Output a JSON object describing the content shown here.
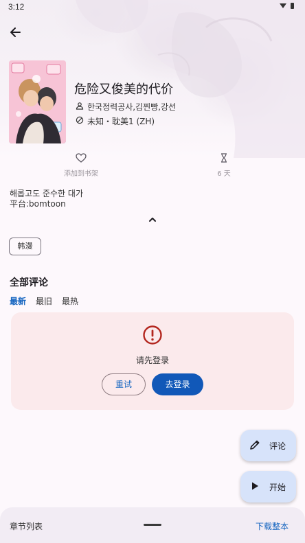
{
  "status_bar": {
    "time": "3:12",
    "icons": "▼ ▮"
  },
  "comic": {
    "title": "危险又俊美的代价",
    "authors": "한국정력공사,김찐빵,강선",
    "status_line": "未知・耽美1 (ZH)",
    "description_line1": "해롭고도 준수한 대가",
    "description_line2": "平台:bomtoon",
    "tag": "韩漫"
  },
  "actions": {
    "bookshelf_label": "添加到书架",
    "days_label": "6 天"
  },
  "comments": {
    "section_title": "全部评论",
    "sort_tabs": [
      "最新",
      "最旧",
      "最热"
    ],
    "active_tab": "最新",
    "login_prompt": "请先登录",
    "retry_label": "重试",
    "login_label": "去登录"
  },
  "fabs": {
    "comment_label": "评论",
    "start_label": "开始"
  },
  "bottom_bar": {
    "chapter_list_label": "章节列表",
    "download_label": "下载整本"
  },
  "colors": {
    "accent": "#1158b8",
    "error": "#b3261e",
    "card_bg": "#fbeaec",
    "fab_bg": "#d7e3fa",
    "sheet_bg": "#f2ecf4"
  }
}
